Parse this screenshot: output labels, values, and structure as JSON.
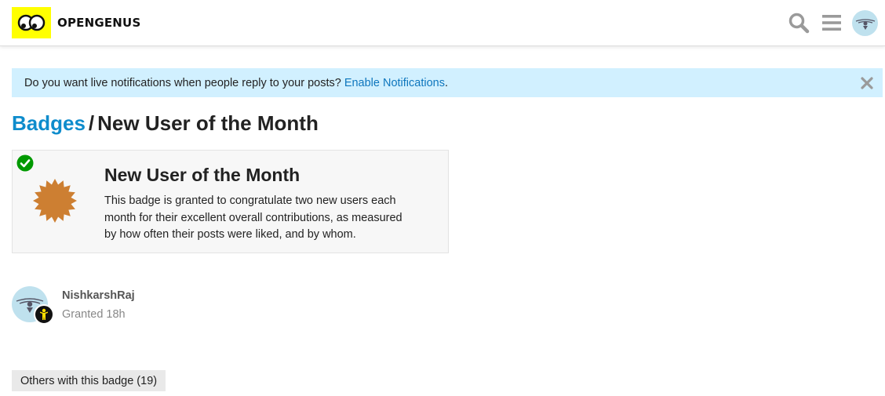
{
  "header": {
    "brand": "OPENGENUS",
    "logo_icon": "opengenus-logo-icon",
    "search_icon": "search-icon",
    "menu_icon": "hamburger-menu-icon",
    "avatar_icon": "user-avatar-icon",
    "brand_color": "#ffff00"
  },
  "notice": {
    "text": "Do you want live notifications when people reply to your posts?",
    "link": "Enable Notifications",
    "suffix": ".",
    "close_icon": "close-icon",
    "background": "#d1f0ff"
  },
  "breadcrumb": {
    "parent": "Badges",
    "separator": "/",
    "current": "New User of the Month"
  },
  "badge": {
    "name": "New User of the Month",
    "description": "This badge is granted to congratulate two new users each month for their excellent overall contributions, as measured by how often their posts were liked, and by whom.",
    "status_icon": "check-circle-icon",
    "badge_icon": "bronze-badge-icon",
    "badge_color": "#cd7f32"
  },
  "granted_user": {
    "username": "NishkarshRaj",
    "granted": "Granted 18h",
    "flair_icon": "new-user-flair-icon"
  },
  "others_button": {
    "label": "Others with this badge (19)"
  }
}
